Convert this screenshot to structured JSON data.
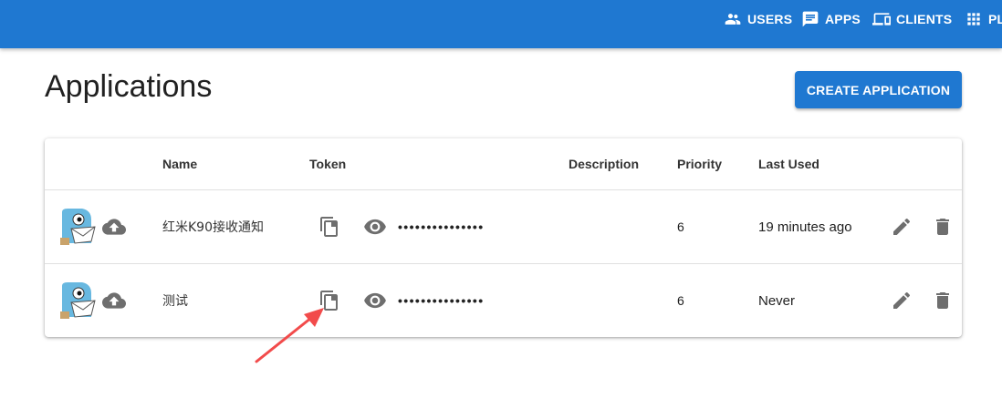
{
  "nav": {
    "users": "USERS",
    "apps": "APPS",
    "clients": "CLIENTS",
    "plugins": "PL"
  },
  "page": {
    "title": "Applications",
    "create_button": "CREATE APPLICATION"
  },
  "table": {
    "headers": {
      "name": "Name",
      "token": "Token",
      "description": "Description",
      "priority": "Priority",
      "last_used": "Last Used"
    },
    "rows": [
      {
        "name": "红米K90接收通知",
        "token_masked": "•••••••••••••••",
        "description": "",
        "priority": "6",
        "last_used": "19 minutes ago"
      },
      {
        "name": "测试",
        "token_masked": "•••••••••••••••",
        "description": "",
        "priority": "6",
        "last_used": "Never"
      }
    ]
  },
  "colors": {
    "appbar": "#1f78d1",
    "button": "#1f78d1",
    "icon_gray": "#6e6e6e",
    "annotation_arrow": "#f24b4b"
  },
  "icons": {
    "users": "people-icon",
    "apps": "message-icon",
    "clients": "devices-icon",
    "plugins": "grid-icon",
    "upload": "cloud-upload-icon",
    "copy": "copy-icon",
    "reveal": "eye-icon",
    "edit": "pencil-icon",
    "delete": "trash-icon"
  }
}
